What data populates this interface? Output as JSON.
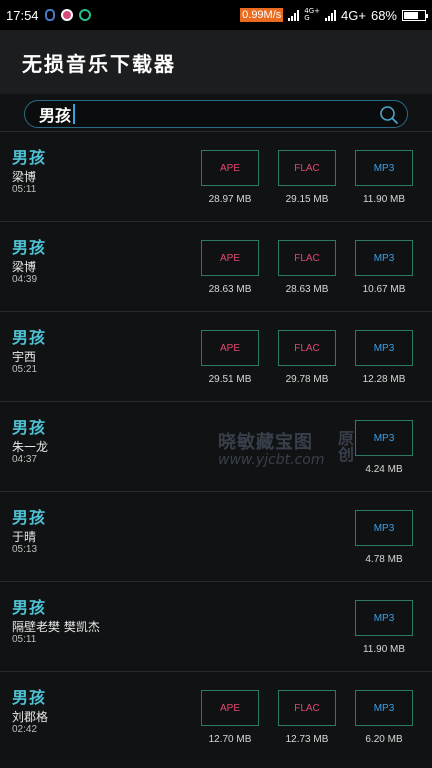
{
  "status_bar": {
    "time": "17:54",
    "speed": "0.99M/s",
    "network_top": "4G+",
    "network_bottom": "G",
    "network": "4G+",
    "battery": "68%",
    "battery_level": 0.68
  },
  "app": {
    "title": "无损音乐下载器"
  },
  "search": {
    "query": "男孩"
  },
  "songs": [
    {
      "title": "男孩",
      "artist": "梁博",
      "duration": "05:11",
      "ape": {
        "label": "APE",
        "size": "28.97 MB"
      },
      "flac": {
        "label": "FLAC",
        "size": "29.15 MB"
      },
      "mp3": {
        "label": "MP3",
        "size": "11.90 MB"
      }
    },
    {
      "title": "男孩",
      "artist": "梁博",
      "duration": "04:39",
      "ape": {
        "label": "APE",
        "size": "28.63 MB"
      },
      "flac": {
        "label": "FLAC",
        "size": "28.63 MB"
      },
      "mp3": {
        "label": "MP3",
        "size": "10.67 MB"
      }
    },
    {
      "title": "男孩",
      "artist": "宇西",
      "duration": "05:21",
      "ape": {
        "label": "APE",
        "size": "29.51 MB"
      },
      "flac": {
        "label": "FLAC",
        "size": "29.78 MB"
      },
      "mp3": {
        "label": "MP3",
        "size": "12.28 MB"
      }
    },
    {
      "title": "男孩",
      "artist": "朱一龙",
      "duration": "04:37",
      "mp3": {
        "label": "MP3",
        "size": "4.24 MB"
      }
    },
    {
      "title": "男孩",
      "artist": "于晴",
      "duration": "05:13",
      "mp3": {
        "label": "MP3",
        "size": "4.78 MB"
      }
    },
    {
      "title": "男孩",
      "artist": "隔壁老樊 樊凯杰",
      "duration": "05:11",
      "mp3": {
        "label": "MP3",
        "size": "11.90 MB"
      }
    },
    {
      "title": "男孩",
      "artist": "刘郡格",
      "duration": "02:42",
      "ape": {
        "label": "APE",
        "size": "12.70 MB"
      },
      "flac": {
        "label": "FLAC",
        "size": "12.73 MB"
      },
      "mp3": {
        "label": "MP3",
        "size": "6.20 MB"
      }
    }
  ],
  "watermark": {
    "line1": "晓敏藏宝图",
    "line2": "www.yjcbt.com",
    "side": "原创"
  },
  "colors": {
    "accent": "#4fc3d6",
    "lossless": "#e24870",
    "mp3": "#3aa0e8",
    "speed_badge": "#e86b1f"
  }
}
